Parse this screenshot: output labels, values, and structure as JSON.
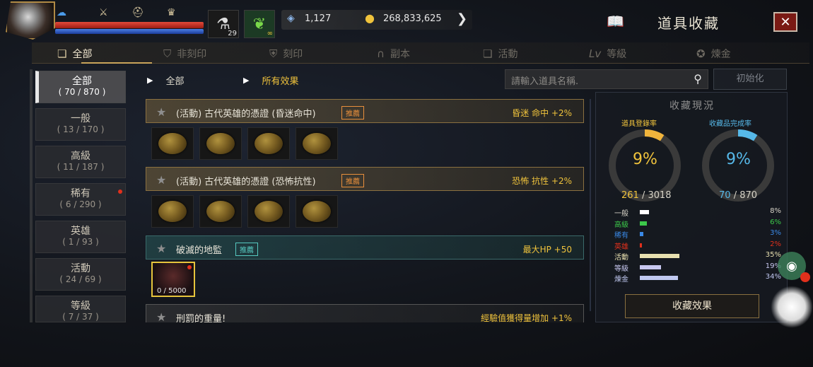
{
  "player": {
    "avatar_icon": "hero-portrait",
    "hp_color": "#e24a3a",
    "mp_color": "#4b7fe4",
    "slot_consumable_count": "29",
    "slot_infinite_label": "∞"
  },
  "top_icons": [
    "speech-icon",
    "sword-icon",
    "helmet-icon",
    "trophy-icon"
  ],
  "resources": {
    "gems": "1,127",
    "gold": "268,833,625"
  },
  "header": {
    "title": "道具收藏",
    "close_label": "✕"
  },
  "tabs": [
    {
      "label": "全部",
      "icon": "book-icon",
      "active": true
    },
    {
      "label": "非刻印",
      "icon": "shield-icon",
      "active": false
    },
    {
      "label": "刻印",
      "icon": "shield-lock-icon",
      "active": false
    },
    {
      "label": "副本",
      "icon": "gate-icon",
      "active": false
    },
    {
      "label": "活動",
      "icon": "gift-icon",
      "active": false
    },
    {
      "label": "等級",
      "icon": "level-icon",
      "active": false
    },
    {
      "label": "煉金",
      "icon": "alchemy-icon",
      "active": false
    }
  ],
  "categories": [
    {
      "name": "全部",
      "count": "( 70 / 870 )",
      "active": true,
      "alert": false
    },
    {
      "name": "一般",
      "count": "( 13 / 170 )",
      "active": false,
      "alert": false
    },
    {
      "name": "高級",
      "count": "( 11 / 187 )",
      "active": false,
      "alert": false
    },
    {
      "name": "稀有",
      "count": "( 6 / 290 )",
      "active": false,
      "alert": true
    },
    {
      "name": "英雄",
      "count": "( 1 / 93 )",
      "active": false,
      "alert": false
    },
    {
      "name": "活動",
      "count": "( 24 / 69 )",
      "active": false,
      "alert": false
    },
    {
      "name": "等級",
      "count": "( 7 / 37 )",
      "active": false,
      "alert": false
    }
  ],
  "filters": {
    "type_value": "全部",
    "effect_value": "所有效果"
  },
  "search": {
    "placeholder": "請輸入道具名稱.",
    "reset_label": "初始化"
  },
  "collections": [
    {
      "title": "(活動) 古代英雄的憑證 (昏迷命中)",
      "badge": "推薦",
      "effect": "昏迷 命中 +2%",
      "style": "gold"
    },
    {
      "title": "(活動) 古代英雄的憑證 (恐怖抗性)",
      "badge": "推薦",
      "effect": "恐怖 抗性 +2%",
      "style": "gold"
    },
    {
      "title": "破滅的地監",
      "badge": "推薦",
      "effect": "最大HP +50",
      "style": "teal",
      "item_count": "0 / 5000"
    },
    {
      "title": "刑罰的重量!",
      "effect": "經驗值獲得量增加 +1%",
      "style": "gray"
    }
  ],
  "panel": {
    "title": "收藏現況",
    "ring1_label": "道具登錄率",
    "ring1_pct": "9%",
    "ring1_value": 0.09,
    "ring1_num": "261",
    "ring1_total": "/ 3018",
    "ring2_label": "收藏品完成率",
    "ring2_pct": "9%",
    "ring2_value": 0.09,
    "ring2_num": "70",
    "ring2_total": "/ 870",
    "stats": [
      {
        "name": "一般",
        "pct": "8%",
        "value": 0.08,
        "color": "#ffffff"
      },
      {
        "name": "高級",
        "pct": "6%",
        "value": 0.06,
        "color": "#3cc84a"
      },
      {
        "name": "稀有",
        "pct": "3%",
        "value": 0.03,
        "color": "#3a8ae8"
      },
      {
        "name": "英雄",
        "pct": "2%",
        "value": 0.02,
        "color": "#e0301c"
      },
      {
        "name": "活動",
        "pct": "35%",
        "value": 0.35,
        "color": "#e8e0b0"
      },
      {
        "name": "等級",
        "pct": "19%",
        "value": 0.19,
        "color": "#c8c8f0"
      },
      {
        "name": "煉金",
        "pct": "34%",
        "value": 0.34,
        "color": "#c0c8f0"
      }
    ],
    "effect_button": "收藏效果"
  }
}
